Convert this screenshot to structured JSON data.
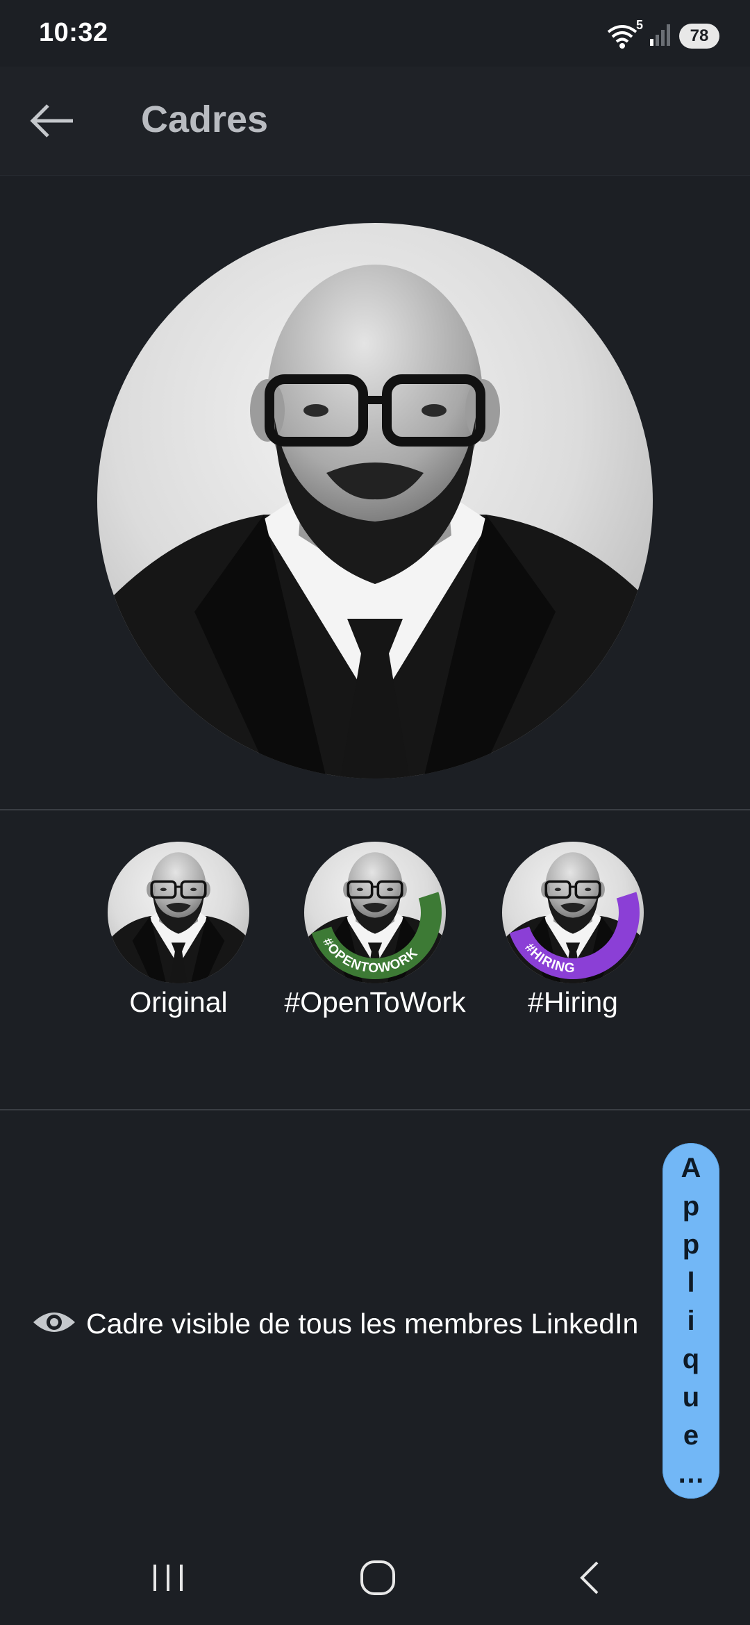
{
  "status_bar": {
    "time": "10:32",
    "wifi_badge": "5",
    "battery": "78"
  },
  "app_bar": {
    "title": "Cadres",
    "back_icon": "arrow-left-icon"
  },
  "frames": [
    {
      "label": "Original",
      "ring": "none",
      "ring_text": ""
    },
    {
      "label": "#OpenToWork",
      "ring": "#3d7a35",
      "ring_text": "#OPENTOWORK"
    },
    {
      "label": "#Hiring",
      "ring": "#8b3fd6",
      "ring_text": "#HIRING"
    }
  ],
  "visibility": {
    "icon": "eye-icon",
    "text": "Cadre visible de tous les membres LinkedIn"
  },
  "apply_button": {
    "letters": [
      "A",
      "p",
      "p",
      "l",
      "i",
      "q",
      "u",
      "e",
      "…"
    ]
  },
  "nav_bar": {
    "recents_icon": "recents-icon",
    "home_icon": "home-icon",
    "back_icon": "back-chevron-icon"
  },
  "colors": {
    "background": "#1c1f24",
    "accent": "#72b7f6",
    "open_to_work": "#3d7a35",
    "hiring": "#8b3fd6"
  }
}
